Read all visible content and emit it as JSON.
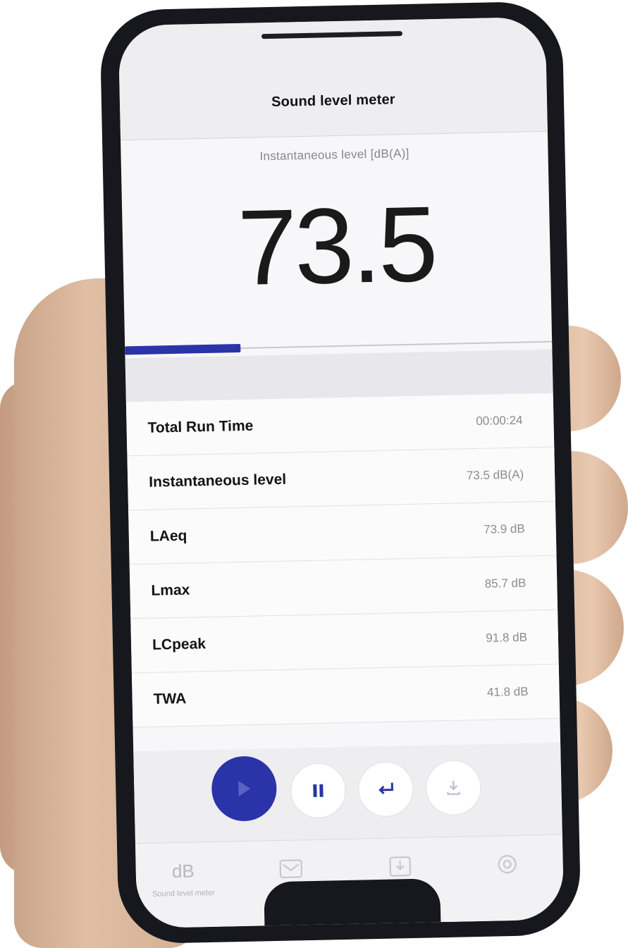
{
  "app": {
    "title": "Sound level meter"
  },
  "meter": {
    "caption": "Instantaneous level [dB(A)]",
    "value": "73.5",
    "level_fraction": 0.27,
    "accent_color": "#2a33a8"
  },
  "stats": [
    {
      "label": "Total Run Time",
      "value": "00:00:24"
    },
    {
      "label": "Instantaneous level",
      "value": "73.5 dB(A)"
    },
    {
      "label": "LAeq",
      "value": "73.9 dB"
    },
    {
      "label": "Lmax",
      "value": "85.7 dB"
    },
    {
      "label": "LCpeak",
      "value": "91.8 dB"
    },
    {
      "label": "TWA",
      "value": "41.8 dB"
    }
  ],
  "controls": {
    "play_icon": "play-icon",
    "pause_icon": "pause-icon",
    "reset_icon": "return-icon",
    "save_icon": "download-icon"
  },
  "tabs": [
    {
      "label": "Sound level meter",
      "icon_text": "dB",
      "icon": "db-icon"
    },
    {
      "label": "",
      "icon": "mail-icon"
    },
    {
      "label": "",
      "icon": "download-box-icon"
    },
    {
      "label": "",
      "icon": "gear-icon"
    }
  ]
}
